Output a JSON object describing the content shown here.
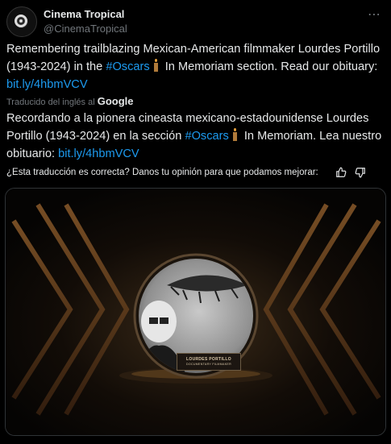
{
  "tweet": {
    "author": {
      "display_name": "Cinema Tropical",
      "handle": "@CinemaTropical",
      "avatar_icon": "film-reel-logo-icon"
    },
    "more_icon": "⋯",
    "text": {
      "part1": "Remembering trailblazing Mexican-American filmmaker Lourdes Portillo (1943-2024) in the ",
      "hashtag": "#Oscars",
      "part2": " In Memoriam section. Read our obituary: ",
      "link": "bit.ly/4hbmVCV"
    },
    "translation": {
      "label": "Traducido del inglés al",
      "provider": "Google",
      "part1": "Recordando a la pionera cineasta mexicano-estadounidense Lourdes Portillo (1943-2024) en la sección ",
      "hashtag": "#Oscars",
      "part2": " In Memoriam. Lea nuestro obituario: ",
      "link": "bit.ly/4hbmVCV"
    },
    "feedback": {
      "prompt": "¿Esta traducción es correcta? Danos tu opinión para que podamos mejorar:",
      "thumbs_up_icon": "thumbs-up-icon",
      "thumbs_down_icon": "thumbs-down-icon"
    },
    "media": {
      "nameplate_name": "LOURDES PORTILLO",
      "nameplate_title": "DOCUMENTARY FILMMAKER"
    }
  },
  "colors": {
    "background": "#000000",
    "text": "#e7e9ea",
    "secondary": "#71767b",
    "link": "#1d9bf0"
  }
}
